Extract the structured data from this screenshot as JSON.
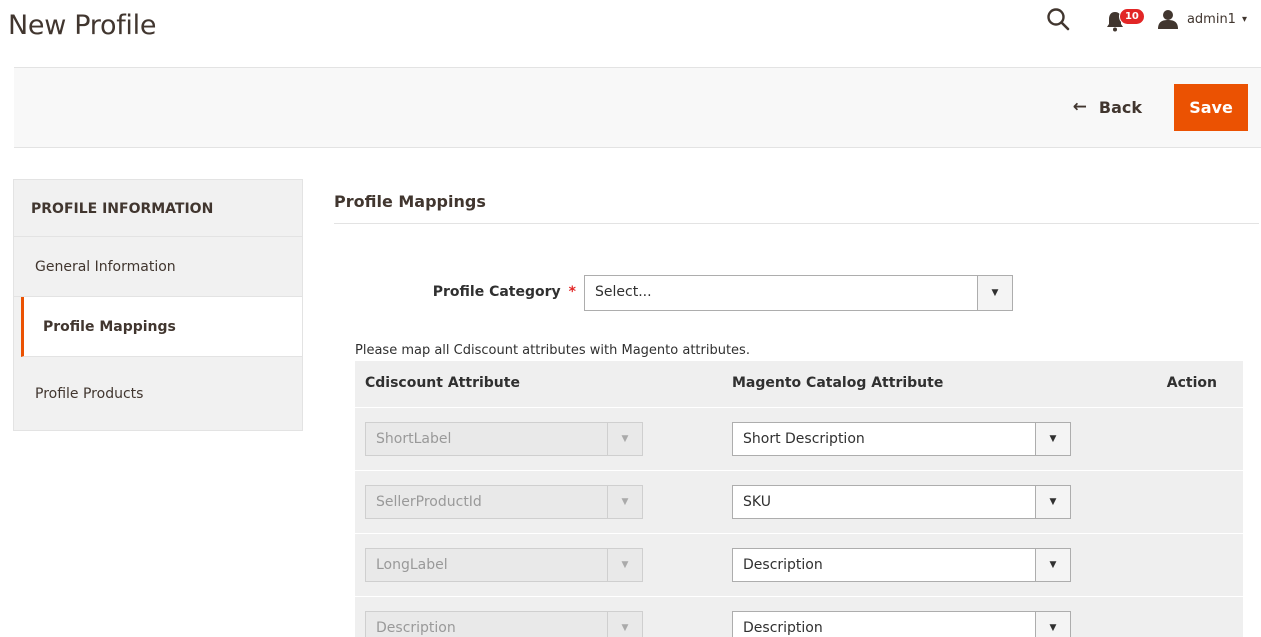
{
  "page": {
    "title": "New Profile"
  },
  "header": {
    "search_icon": "search-icon",
    "notifications": {
      "icon": "bell-icon",
      "count": "10"
    },
    "user": {
      "icon": "user-icon",
      "name": "admin1",
      "caret": "▾"
    }
  },
  "actions": {
    "back_arrow": "←",
    "back_label": "Back",
    "save_label": "Save",
    "save_color": "#eb5202"
  },
  "sidebar": {
    "title": "PROFILE INFORMATION",
    "items": [
      {
        "label": "General Information",
        "active": false
      },
      {
        "label": "Profile Mappings",
        "active": true
      },
      {
        "label": "Profile Products",
        "active": false
      }
    ]
  },
  "main": {
    "section_title": "Profile Mappings",
    "profile_category": {
      "label": "Profile Category",
      "required_mark": "*",
      "value": "Select..."
    },
    "hint": "Please map all Cdiscount attributes with Magento attributes.",
    "grid": {
      "columns": [
        "Cdiscount Attribute",
        "Magento Catalog Attribute",
        "Action"
      ],
      "rows": [
        {
          "cdiscount": "ShortLabel",
          "magento": "Short Description"
        },
        {
          "cdiscount": "SellerProductId",
          "magento": "SKU"
        },
        {
          "cdiscount": "LongLabel",
          "magento": "Description"
        },
        {
          "cdiscount": "Description",
          "magento": "Description"
        }
      ]
    },
    "dropdown_arrow": "▼"
  }
}
